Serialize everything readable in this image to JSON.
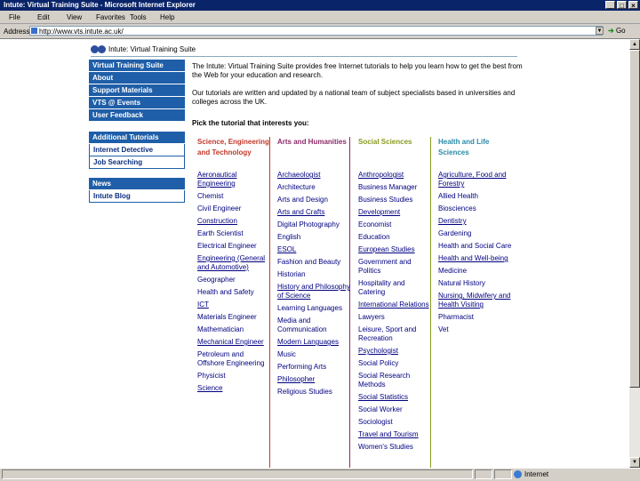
{
  "window": {
    "title": "Intute: Virtual Training Suite - Microsoft Internet Explorer",
    "controls": [
      "_",
      "□",
      "×"
    ]
  },
  "menu": [
    "File",
    "Edit",
    "View",
    "Favorites",
    "Tools",
    "Help"
  ],
  "address": {
    "label": "Address",
    "url": "http://www.vts.intute.ac.uk/",
    "go": "Go"
  },
  "status": {
    "zone": "Internet"
  },
  "page": {
    "logo_text": "Intute: Virtual Training Suite",
    "nav_main": [
      "Virtual Training Suite",
      "About",
      "Support Materials",
      "VTS @ Events",
      "User Feedback"
    ],
    "nav_extra_header": "Additional Tutorials",
    "nav_extra": [
      "Internet Detective",
      "Job Searching"
    ],
    "nav_news_header": "News",
    "nav_news": [
      "Intute Blog"
    ],
    "intro_1": "The Intute: Virtual Training Suite provides free Internet tutorials to help you learn how to get the best from the Web for your education and research.",
    "intro_2": "Our tutorials are written and updated by a national team of subject specialists based in universities and colleges across the UK.",
    "pick": "Pick the tutorial that interests you:",
    "columns": [
      {
        "header": "Science, Engineering and Technology",
        "color": "#c0392b",
        "items": [
          "Aeronautical Engineering",
          "Chemist",
          "Civil Engineer",
          "Construction",
          "Earth Scientist",
          "Electrical Engineer",
          "Engineering (General and Automotive)",
          "Geographer",
          "Health and Safety",
          "ICT",
          "Materials Engineer",
          "Mathematician",
          "Mechanical Engineer",
          "Petroleum and Offshore Engineering",
          "Physicist",
          "Science"
        ]
      },
      {
        "header": "Arts and Humanities",
        "color": "#8e2a6a",
        "items": [
          "Archaeologist",
          "Architecture",
          "Arts and Design",
          "Arts and Crafts",
          "Digital Photography",
          "English",
          "ESOL",
          "Fashion and Beauty",
          "Historian",
          "History and Philosophy of Science",
          "Learning Languages",
          "Media and Communication",
          "Modern Languages",
          "Music",
          "Performing Arts",
          "Philosopher",
          "Religious Studies"
        ]
      },
      {
        "header": "Social Sciences",
        "color": "#8a9a1f",
        "items": [
          "Anthropologist",
          "Business Manager",
          "Business Studies",
          "Development",
          "Economist",
          "Education",
          "European Studies",
          "Government and Politics",
          "Hospitality and Catering",
          "International Relations",
          "Lawyers",
          "Leisure, Sport and Recreation",
          "Psychologist",
          "Social Policy",
          "Social Research Methods",
          "Social Statistics",
          "Social Worker",
          "Sociologist",
          "Travel and Tourism",
          "Women's Studies"
        ]
      },
      {
        "header": "Health and Life Sciences",
        "color": "#2a8aa8",
        "items": [
          "Agriculture, Food and Forestry",
          "Allied Health",
          "Biosciences",
          "Dentistry",
          "Gardening",
          "Health and Social Care",
          "Health and Well-being",
          "Medicine",
          "Natural History",
          "Nursing, Midwifery and Health Visiting",
          "Pharmacist",
          "Vet"
        ]
      }
    ]
  }
}
